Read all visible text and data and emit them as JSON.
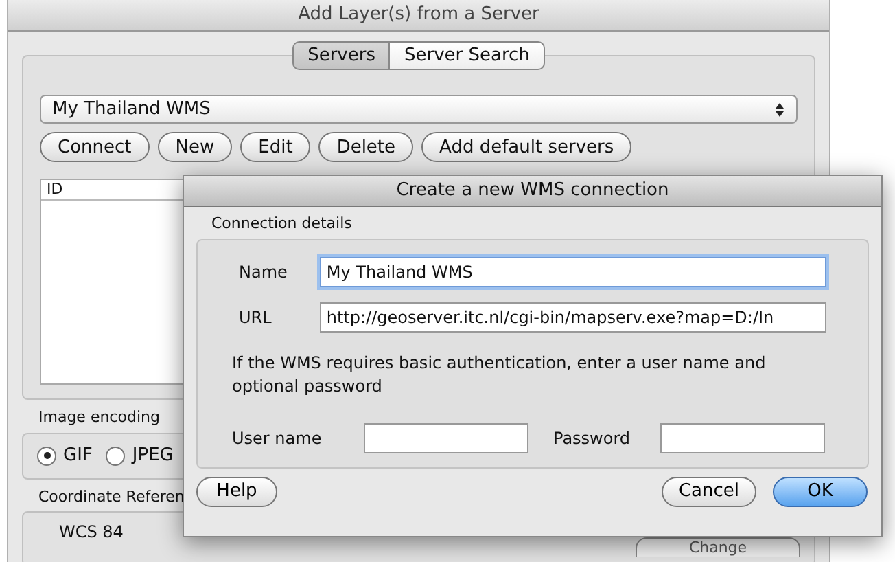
{
  "window": {
    "title": "Add Layer(s) from a Server"
  },
  "tabs": [
    {
      "label": "Servers",
      "selected": true
    },
    {
      "label": "Server Search",
      "selected": false
    }
  ],
  "server_select": {
    "value": "My Thailand WMS"
  },
  "server_buttons": [
    "Connect",
    "New",
    "Edit",
    "Delete",
    "Add default servers"
  ],
  "layers_table": {
    "columns": [
      "ID"
    ]
  },
  "image_encoding": {
    "label": "Image encoding",
    "options": [
      {
        "label": "GIF",
        "selected": true
      },
      {
        "label": "JPEG",
        "selected": false
      }
    ]
  },
  "coordinate_reference": {
    "label": "Coordinate Referen",
    "value": "WCS 84",
    "button": "Change"
  },
  "dialog": {
    "title": "Create a new WMS connection",
    "group_label": "Connection details",
    "name": {
      "label": "Name",
      "value": "My Thailand WMS",
      "focused": true
    },
    "url": {
      "label": "URL",
      "value": "http://geoserver.itc.nl/cgi-bin/mapserv.exe?map=D:/In",
      "focused": false
    },
    "auth_note": "If the WMS requires basic authentication, enter a user name and optional password",
    "username": {
      "label": "User name"
    },
    "password": {
      "label": "Password"
    },
    "buttons": [
      {
        "label": "Help",
        "kind": "help"
      },
      {
        "label": "Cancel",
        "kind": "normal"
      },
      {
        "label": "OK",
        "kind": "default"
      }
    ]
  }
}
